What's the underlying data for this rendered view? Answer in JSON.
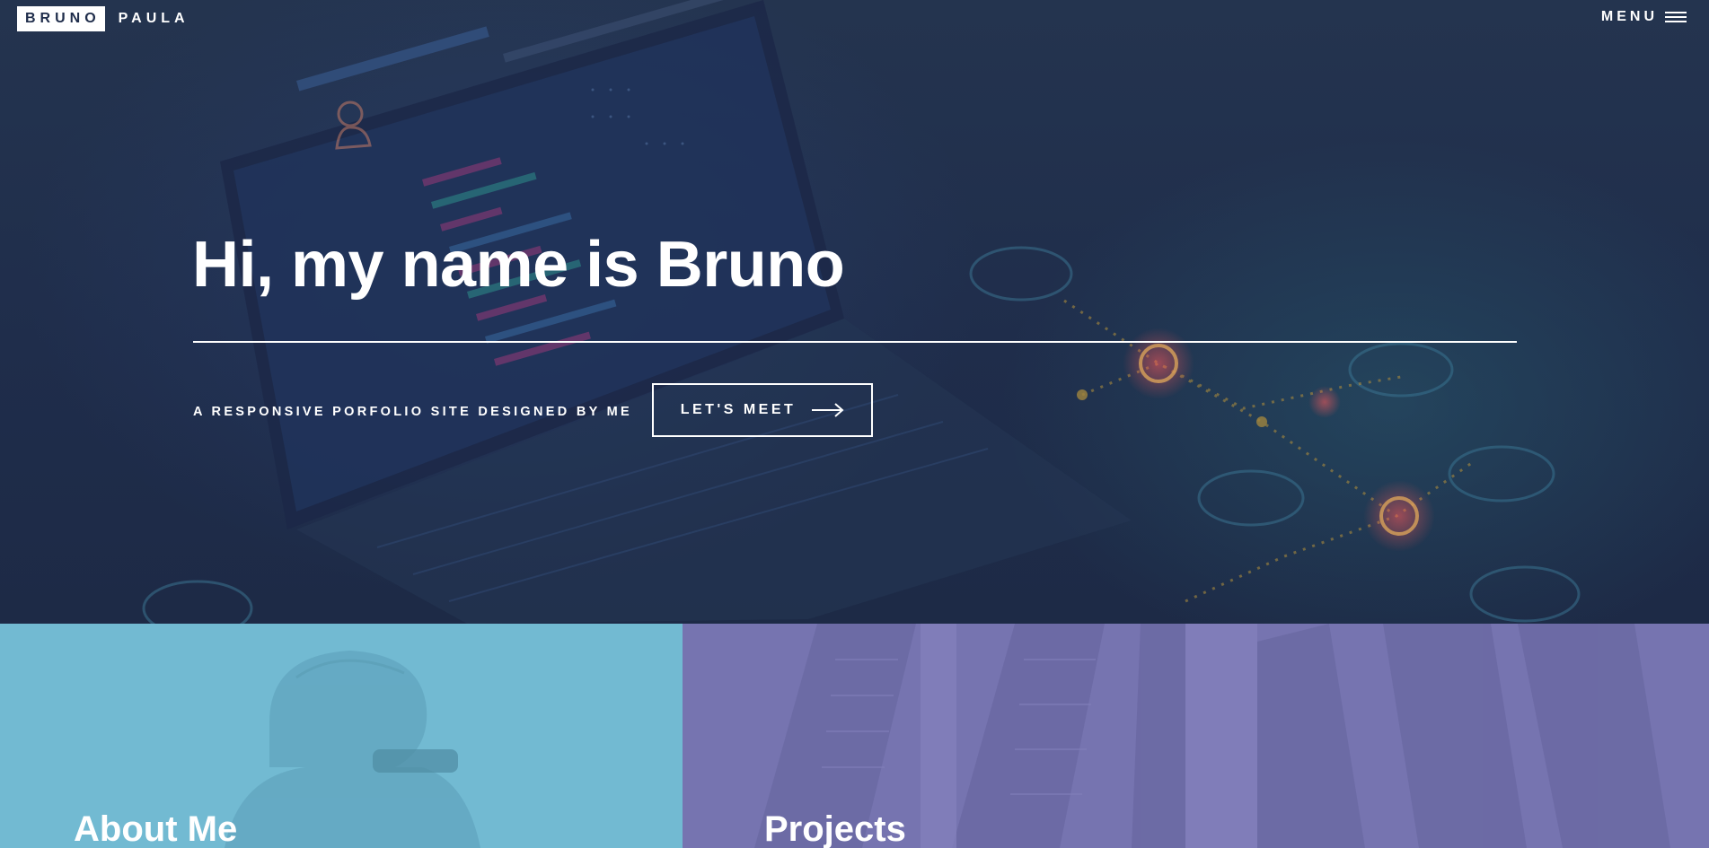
{
  "brand": {
    "first": "BRUNO",
    "last": "PAULA"
  },
  "nav": {
    "menu_label": "MENU",
    "menu_icon": "hamburger-icon"
  },
  "hero": {
    "title": "Hi, my name is Bruno",
    "tagline": "A RESPONSIVE PORFOLIO SITE DESIGNED BY ME",
    "cta_label": "LET'S MEET",
    "cta_icon": "arrow-right-icon"
  },
  "panels": {
    "about": {
      "title": "About Me",
      "color": "#72bad2"
    },
    "projects": {
      "title": "Projects",
      "color": "#7674b0"
    }
  },
  "colors": {
    "hero_background": "#1f2d4b",
    "text": "#ffffff"
  }
}
